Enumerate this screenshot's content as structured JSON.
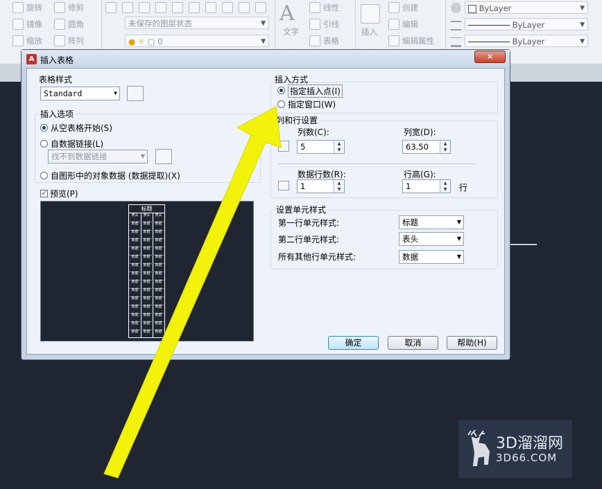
{
  "ribbon": {
    "items": [
      {
        "label": "旋转"
      },
      {
        "label": "修剪"
      },
      {
        "label": "镜像"
      },
      {
        "label": "圆角"
      },
      {
        "label": "缩放"
      },
      {
        "label": "阵列"
      },
      {
        "label": "线性"
      },
      {
        "label": "创建"
      },
      {
        "label": "引线"
      },
      {
        "label": "编辑"
      },
      {
        "label": "表格"
      },
      {
        "label": "编辑属性"
      },
      {
        "label": "文字"
      },
      {
        "label": "插入"
      }
    ],
    "layer_state": "未保存的图层状态",
    "layer_number": "0",
    "bylayer_1": "ByLayer",
    "bylayer_2": "ByLayer",
    "bylayer_3": "ByLayer"
  },
  "dialog": {
    "title": "插入表格",
    "close": "✕",
    "table_style": {
      "label": "表格样式",
      "value": "Standard"
    },
    "insert_options": {
      "label": "插入选项",
      "opt_empty": "从空表格开始(S)",
      "opt_link": "自数据链接(L)",
      "link_placeholder": "找不到数据链接",
      "opt_extract": "自图形中的对象数据 (数据提取)(X)"
    },
    "preview": {
      "label": "预览(P)",
      "header": "标题",
      "col_header": "表头",
      "cell": "数据"
    },
    "insertion": {
      "label": "插入方式",
      "opt_point": "指定插入点(I)",
      "opt_window": "指定窗口(W)"
    },
    "colrow": {
      "label": "列和行设置",
      "cols_label": "列数(C):",
      "cols": "5",
      "colwidth_label": "列宽(D):",
      "colwidth": "63.50",
      "rows_label": "数据行数(R):",
      "rows": "1",
      "rowheight_label": "行高(G):",
      "rowheight": "1",
      "row_unit": "行"
    },
    "cellstyles": {
      "label": "设置单元样式",
      "first_label": "第一行单元样式:",
      "first": "标题",
      "second_label": "第二行单元样式:",
      "second": "表头",
      "other_label": "所有其他行单元样式:",
      "other": "数据"
    },
    "buttons": {
      "ok": "确定",
      "cancel": "取消",
      "help": "帮助(H)"
    }
  },
  "watermark": {
    "brand": "3D溜溜网",
    "site": "3D66.COM"
  },
  "colors": {
    "arrow": "#f2f20a",
    "workspace": "#1f2632",
    "dialog_bg": "#eef3fa"
  }
}
